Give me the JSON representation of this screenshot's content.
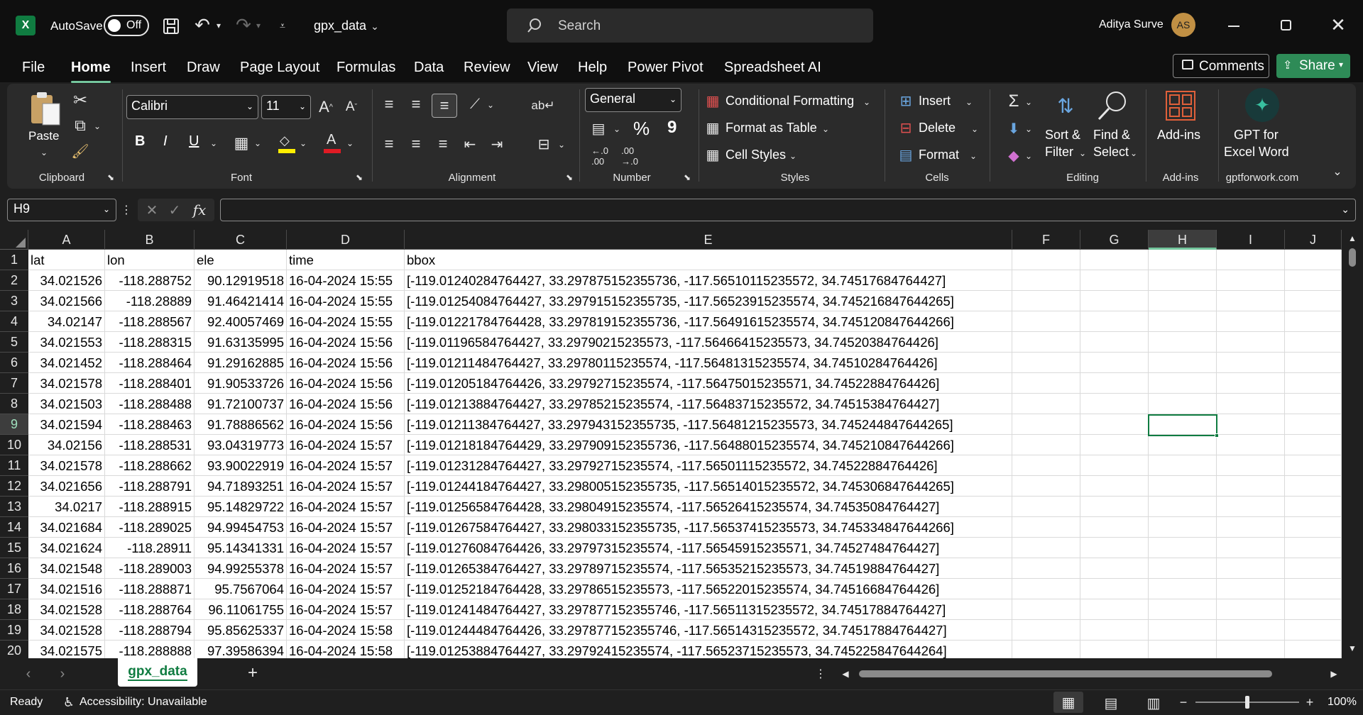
{
  "titlebar": {
    "autosave_label": "AutoSave",
    "autosave_state": "Off",
    "filename": "gpx_data",
    "search_placeholder": "Search",
    "user_name": "Aditya Surve",
    "user_initials": "AS"
  },
  "menu": {
    "items": [
      "File",
      "Home",
      "Insert",
      "Draw",
      "Page Layout",
      "Formulas",
      "Data",
      "Review",
      "View",
      "Help",
      "Power Pivot",
      "Spreadsheet AI"
    ],
    "active": "Home",
    "comments_label": "Comments",
    "share_label": "Share"
  },
  "ribbon": {
    "clipboard": {
      "paste": "Paste",
      "group": "Clipboard"
    },
    "font": {
      "name": "Calibri",
      "size": "11",
      "group": "Font",
      "bold": "B",
      "italic": "I",
      "underline": "U"
    },
    "alignment": {
      "group": "Alignment"
    },
    "number": {
      "format": "General",
      "percent": "%",
      "comma": "9",
      "group": "Number"
    },
    "styles": {
      "conditional": "Conditional Formatting",
      "format_table": "Format as Table",
      "cell_styles": "Cell Styles",
      "group": "Styles"
    },
    "cells": {
      "insert": "Insert",
      "delete": "Delete",
      "format": "Format",
      "group": "Cells"
    },
    "editing": {
      "sort_line1": "Sort &",
      "sort_line2": "Filter",
      "find_line1": "Find &",
      "find_line2": "Select",
      "group": "Editing"
    },
    "addins": {
      "label": "Add-ins",
      "group": "Add-ins"
    },
    "gpt": {
      "line1": "GPT for",
      "line2": "Excel Word",
      "group": "gptforwork.com"
    }
  },
  "formula_bar": {
    "name_box": "H9",
    "fx": "fx",
    "content": ""
  },
  "sheet": {
    "columns": [
      "A",
      "B",
      "C",
      "D",
      "E",
      "F",
      "G",
      "H",
      "I",
      "J"
    ],
    "selected_column": "H",
    "selected_row": "9",
    "rows": [
      {
        "n": "1",
        "a": "lat",
        "b": "lon",
        "c": "ele",
        "d": "time",
        "e": "bbox"
      },
      {
        "n": "2",
        "a": "34.021526",
        "b": "-118.288752",
        "c": "90.12919518",
        "d": "16-04-2024 15:55",
        "e": "[-119.01240284764427, 33.297875152355736, -117.56510115235572, 34.74517684764427]"
      },
      {
        "n": "3",
        "a": "34.021566",
        "b": "-118.28889",
        "c": "91.46421414",
        "d": "16-04-2024 15:55",
        "e": "[-119.01254084764427, 33.297915152355735, -117.56523915235574, 34.745216847644265]"
      },
      {
        "n": "4",
        "a": "34.02147",
        "b": "-118.288567",
        "c": "92.40057469",
        "d": "16-04-2024 15:55",
        "e": "[-119.01221784764428, 33.297819152355736, -117.56491615235574, 34.745120847644266]"
      },
      {
        "n": "5",
        "a": "34.021553",
        "b": "-118.288315",
        "c": "91.63135995",
        "d": "16-04-2024 15:56",
        "e": "[-119.01196584764427, 33.29790215235573, -117.56466415235573, 34.74520384764426]"
      },
      {
        "n": "6",
        "a": "34.021452",
        "b": "-118.288464",
        "c": "91.29162885",
        "d": "16-04-2024 15:56",
        "e": "[-119.01211484764427, 33.29780115235574, -117.56481315235574, 34.74510284764426]"
      },
      {
        "n": "7",
        "a": "34.021578",
        "b": "-118.288401",
        "c": "91.90533726",
        "d": "16-04-2024 15:56",
        "e": "[-119.01205184764426, 33.29792715235574, -117.56475015235571, 34.74522884764426]"
      },
      {
        "n": "8",
        "a": "34.021503",
        "b": "-118.288488",
        "c": "91.72100737",
        "d": "16-04-2024 15:56",
        "e": "[-119.01213884764427, 33.29785215235574, -117.56483715235572, 34.74515384764427]"
      },
      {
        "n": "9",
        "a": "34.021594",
        "b": "-118.288463",
        "c": "91.78886562",
        "d": "16-04-2024 15:56",
        "e": "[-119.01211384764427, 33.297943152355735, -117.56481215235573, 34.745244847644265]"
      },
      {
        "n": "10",
        "a": "34.02156",
        "b": "-118.288531",
        "c": "93.04319773",
        "d": "16-04-2024 15:57",
        "e": "[-119.01218184764429, 33.297909152355736, -117.56488015235574, 34.745210847644266]"
      },
      {
        "n": "11",
        "a": "34.021578",
        "b": "-118.288662",
        "c": "93.90022919",
        "d": "16-04-2024 15:57",
        "e": "[-119.01231284764427, 33.29792715235574, -117.56501115235572, 34.74522884764426]"
      },
      {
        "n": "12",
        "a": "34.021656",
        "b": "-118.288791",
        "c": "94.71893251",
        "d": "16-04-2024 15:57",
        "e": "[-119.01244184764427, 33.298005152355735, -117.56514015235572, 34.745306847644265]"
      },
      {
        "n": "13",
        "a": "34.0217",
        "b": "-118.288915",
        "c": "95.14829722",
        "d": "16-04-2024 15:57",
        "e": "[-119.01256584764428, 33.29804915235574, -117.56526415235574, 34.74535084764427]"
      },
      {
        "n": "14",
        "a": "34.021684",
        "b": "-118.289025",
        "c": "94.99454753",
        "d": "16-04-2024 15:57",
        "e": "[-119.01267584764427, 33.298033152355735, -117.56537415235573, 34.745334847644266]"
      },
      {
        "n": "15",
        "a": "34.021624",
        "b": "-118.28911",
        "c": "95.14341331",
        "d": "16-04-2024 15:57",
        "e": "[-119.01276084764426, 33.29797315235574, -117.56545915235571, 34.74527484764427]"
      },
      {
        "n": "16",
        "a": "34.021548",
        "b": "-118.289003",
        "c": "94.99255378",
        "d": "16-04-2024 15:57",
        "e": "[-119.01265384764427, 33.29789715235574, -117.56535215235573, 34.74519884764427]"
      },
      {
        "n": "17",
        "a": "34.021516",
        "b": "-118.288871",
        "c": "95.7567064",
        "d": "16-04-2024 15:57",
        "e": "[-119.01252184764428, 33.29786515235573, -117.56522015235574, 34.74516684764426]"
      },
      {
        "n": "18",
        "a": "34.021528",
        "b": "-118.288764",
        "c": "96.11061755",
        "d": "16-04-2024 15:57",
        "e": "[-119.01241484764427, 33.297877152355746, -117.56511315235572, 34.74517884764427]"
      },
      {
        "n": "19",
        "a": "34.021528",
        "b": "-118.288794",
        "c": "95.85625337",
        "d": "16-04-2024 15:58",
        "e": "[-119.01244484764426, 33.297877152355746, -117.56514315235572, 34.74517884764427]"
      },
      {
        "n": "20",
        "a": "34.021575",
        "b": "-118.288888",
        "c": "97.39586394",
        "d": "16-04-2024 15:58",
        "e": "[-119.01253884764427, 33.29792415235574, -117.56523715235573, 34.745225847644264]"
      }
    ]
  },
  "sheet_tab": {
    "name": "gpx_data",
    "add": "+"
  },
  "status": {
    "ready": "Ready",
    "accessibility": "Accessibility: Unavailable",
    "zoom": "100%",
    "zoom_level_percent": 100
  }
}
